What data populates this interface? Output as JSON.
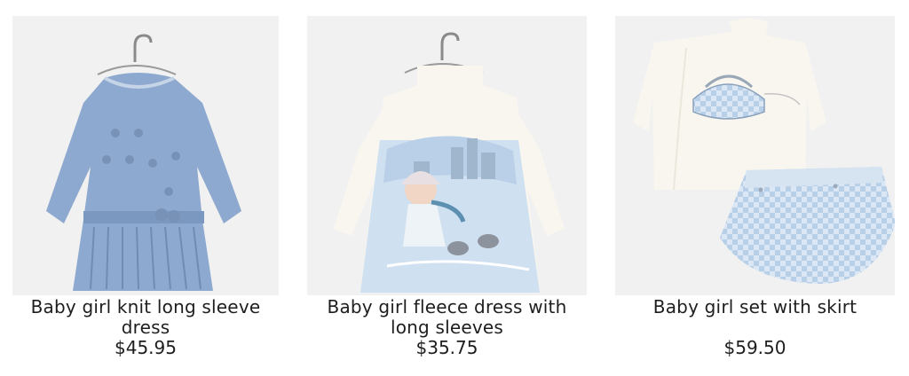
{
  "products": [
    {
      "name": "Baby girl knit long sleeve dress",
      "price": "$45.95",
      "image_icon": "blue-knit-dress-on-hanger"
    },
    {
      "name": "Baby girl fleece dress with long sleeves",
      "price": "$35.75",
      "image_icon": "fleece-dress-winter-print-on-hanger"
    },
    {
      "name": "Baby girl set with skirt",
      "price": "$59.50",
      "image_icon": "top-and-checked-skirt-set"
    }
  ],
  "colors": {
    "image_background": "#f1f1f1",
    "knit_blue": "#8ea9cf",
    "cream": "#f8f6ef",
    "pale_blue": "#cfe0f1"
  }
}
